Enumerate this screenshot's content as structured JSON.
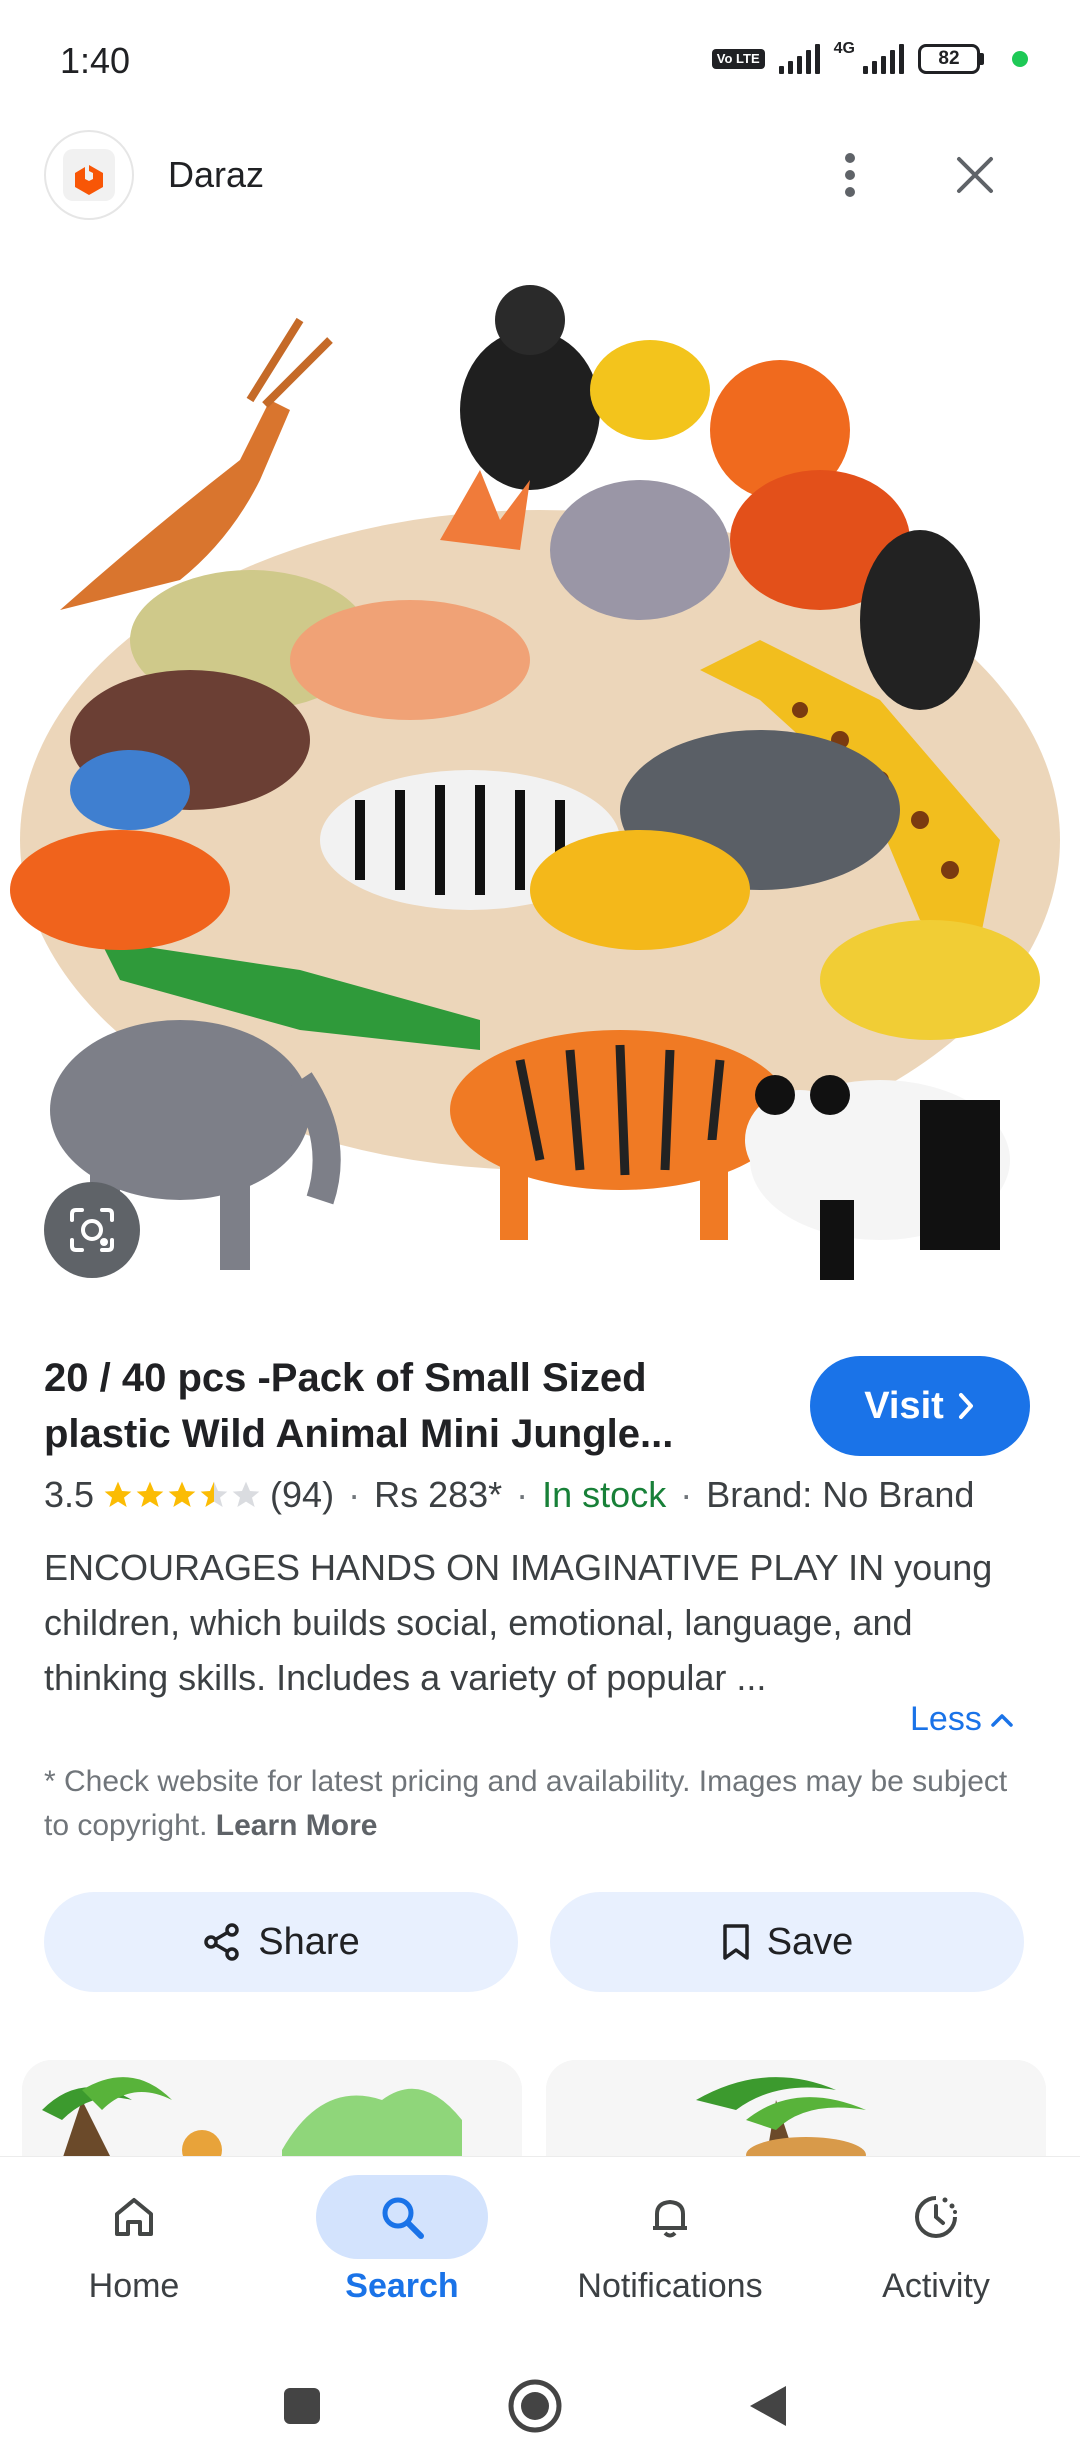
{
  "status_bar": {
    "time": "1:40",
    "volte_label": "Vo LTE",
    "network_label": "4G",
    "battery_level": "82"
  },
  "header": {
    "site_name": "Daraz",
    "logo_color": "#f85606"
  },
  "product": {
    "title": "20 / 40 pcs -Pack of Small Sized plastic Wild Animal Mini Jungle...",
    "visit_label": "Visit",
    "rating": "3.5",
    "rating_value": 3.5,
    "reviews": "(94)",
    "price": "Rs 283*",
    "stock": "In stock",
    "brand": "Brand: No Brand",
    "description": "ENCOURAGES HANDS ON IMAGINATIVE PLAY IN young children, which builds social, emotional, language, and thinking skills. Includes a variety of popular ...",
    "less_label": "Less",
    "disclaimer": "* Check website for latest pricing and availability. Images may be subject to copyright.",
    "learn_more": "Learn More"
  },
  "actions": {
    "share_label": "Share",
    "save_label": "Save"
  },
  "bottom_nav": {
    "items": [
      {
        "label": "Home",
        "icon": "home-icon"
      },
      {
        "label": "Search",
        "icon": "search-icon",
        "active": true
      },
      {
        "label": "Notifications",
        "icon": "bell-icon"
      },
      {
        "label": "Activity",
        "icon": "activity-icon"
      }
    ]
  },
  "colors": {
    "accent": "#1a73e8",
    "in_stock": "#188038",
    "star": "#fbbc04",
    "chip_bg": "#e8f0fe"
  }
}
